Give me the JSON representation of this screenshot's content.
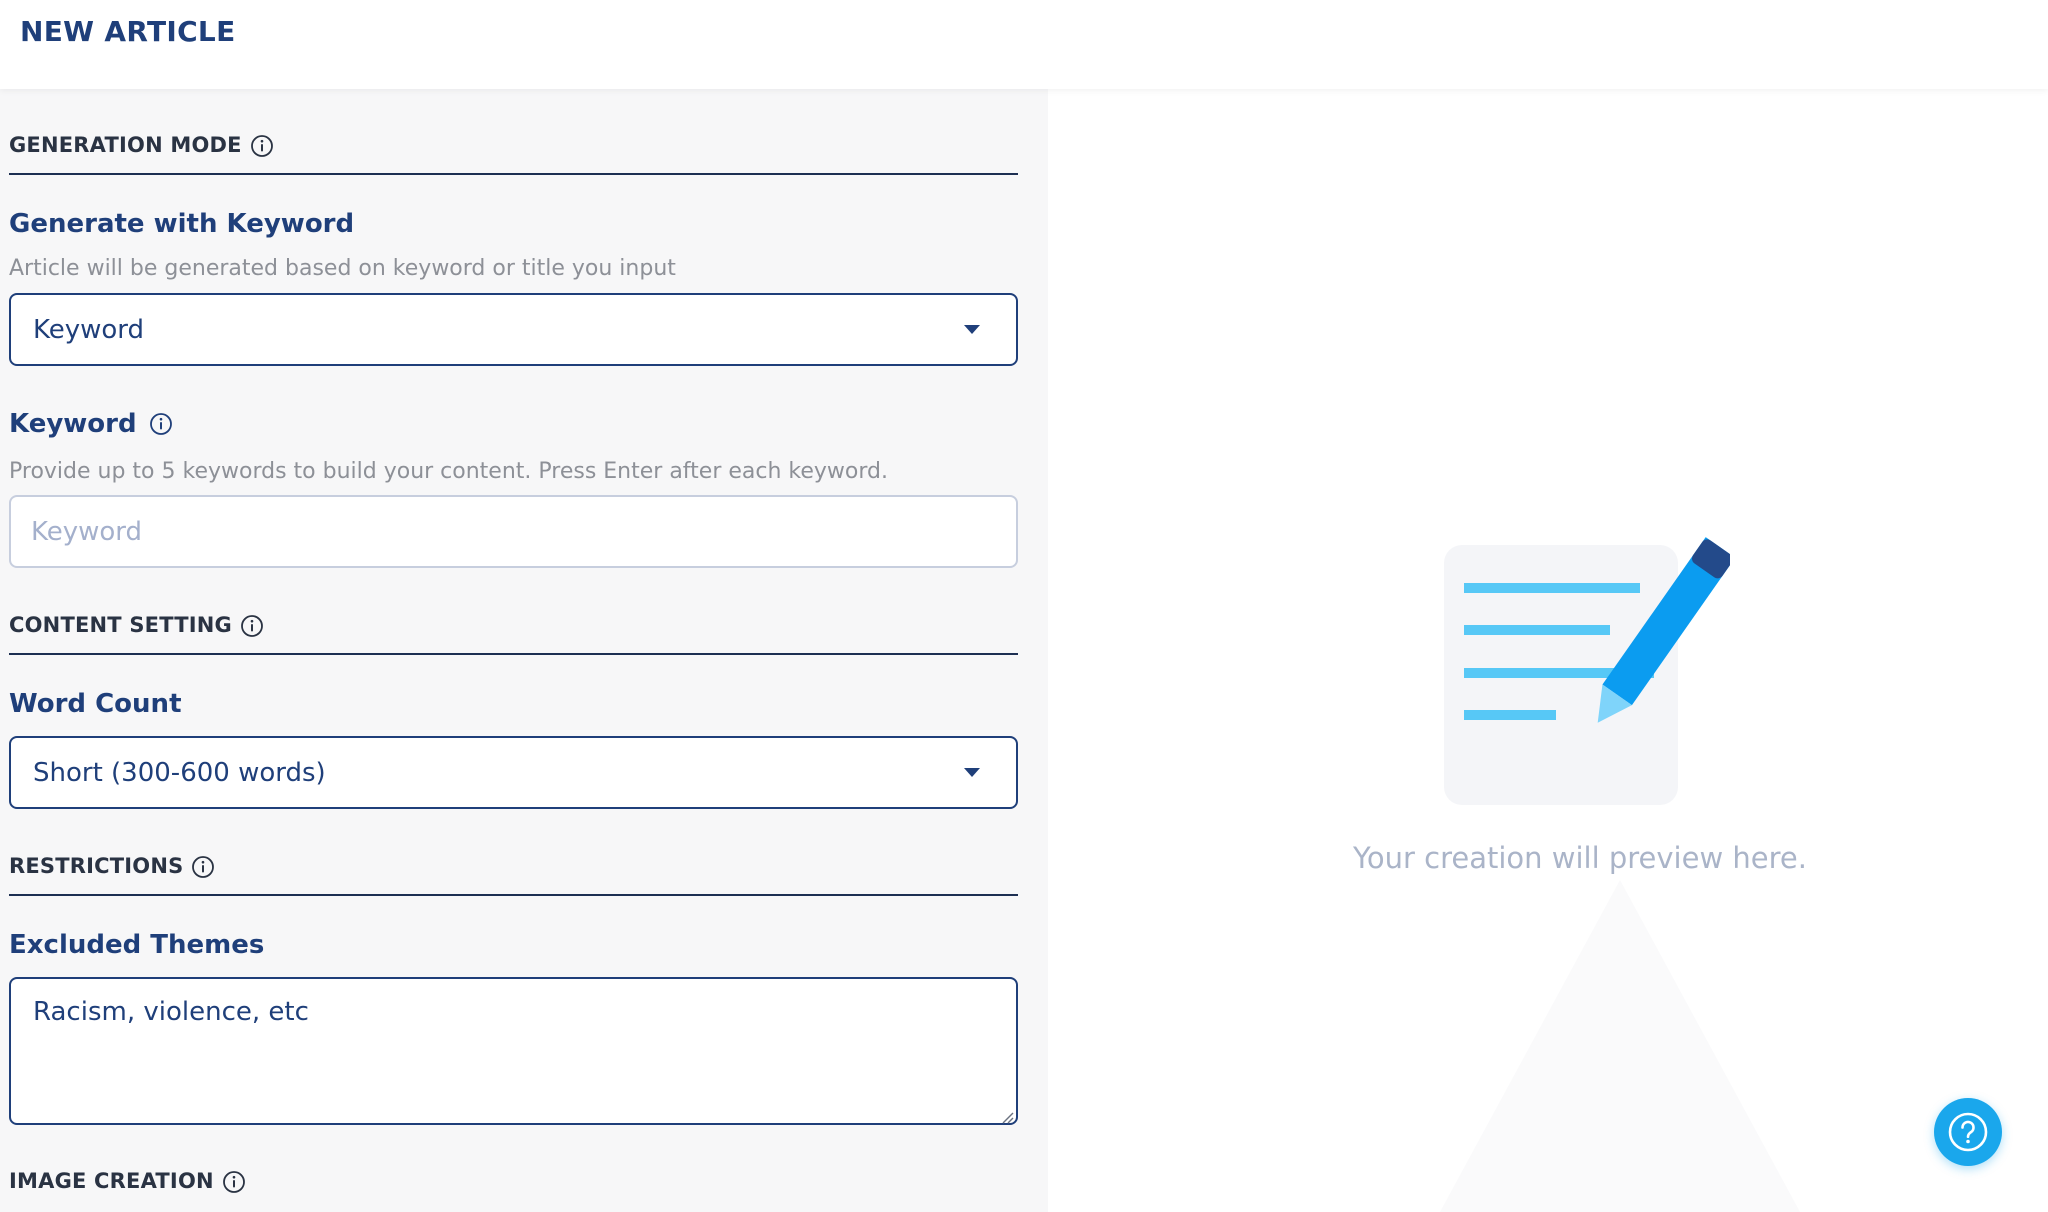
{
  "header": {
    "title": "NEW ARTICLE"
  },
  "form": {
    "generation_mode": {
      "section_title": "GENERATION MODE",
      "label": "Generate with Keyword",
      "help": "Article will be generated based on keyword or title you input",
      "selected": "Keyword"
    },
    "keyword": {
      "label": "Keyword",
      "help": "Provide up to 5 keywords to build your content. Press Enter after each keyword.",
      "placeholder": "Keyword",
      "value": ""
    },
    "content_setting": {
      "section_title": "CONTENT SETTING",
      "word_count_label": "Word Count",
      "word_count_selected": "Short (300-600 words)"
    },
    "restrictions": {
      "section_title": "RESTRICTIONS",
      "excluded_label": "Excluded Themes",
      "excluded_value": "Racism, violence, etc"
    },
    "image_creation": {
      "section_title": "IMAGE CREATION"
    }
  },
  "preview": {
    "empty_text": "Your creation will preview here."
  },
  "colors": {
    "brand_navy": "#1f3f7a",
    "accent_blue": "#1aa7ec",
    "pencil_blue": "#0b9cf0",
    "line_blue": "#57c8f6"
  },
  "icons": [
    "info-icon",
    "chevron-down-icon",
    "document-pencil-icon",
    "help-icon",
    "resize-grip-icon"
  ]
}
